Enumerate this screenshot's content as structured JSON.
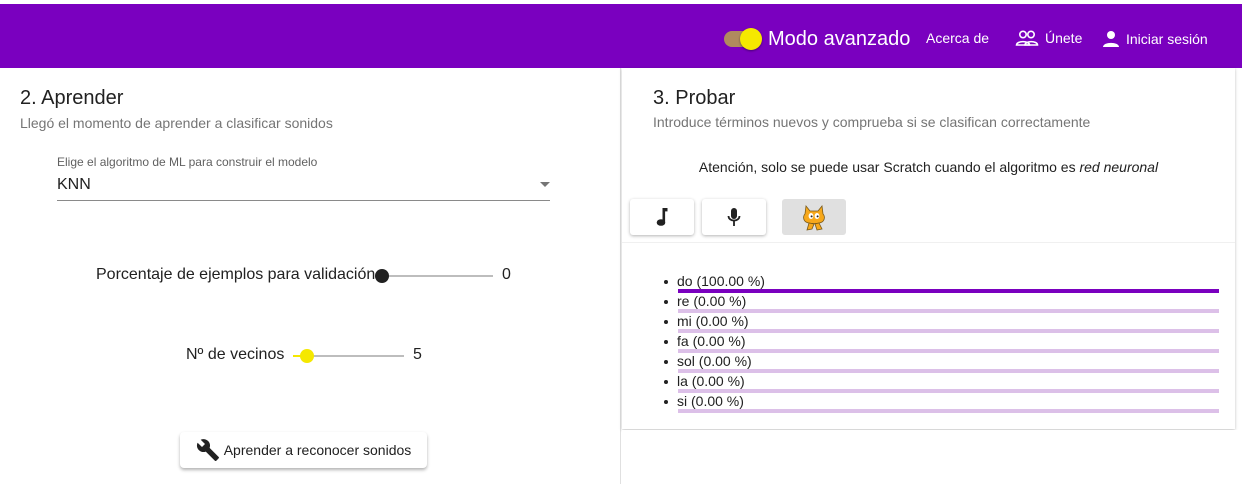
{
  "header": {
    "mode_label": "Modo avanzado",
    "nav": {
      "about": "Acerca de",
      "join": "Únete",
      "login": "Iniciar sesión"
    },
    "accent_color": "#7a00bf"
  },
  "learn": {
    "title": "2. Aprender",
    "subtitle": "Llegó el momento de aprender a clasificar sonidos",
    "algorithm": {
      "label": "Elige el algoritmo de ML para construir el modelo",
      "value": "KNN"
    },
    "validation": {
      "label": "Porcentaje de ejemplos para validación",
      "value": "0"
    },
    "neighbors": {
      "label": "Nº de vecinos",
      "value": "5"
    },
    "train_button": "Aprender a reconocer sonidos"
  },
  "test": {
    "title": "3. Probar",
    "subtitle": "Introduce términos nuevos y comprueba si se clasifican correctamente",
    "notice_prefix": "Atención, solo se puede usar Scratch cuando el algoritmo es ",
    "notice_emphasis": "red neuronal",
    "tabs": [
      "music-note-icon",
      "microphone-icon",
      "scratch-cat-icon"
    ],
    "results": [
      {
        "label": "do (100.00 %)",
        "value": 100
      },
      {
        "label": "re (0.00 %)",
        "value": 0
      },
      {
        "label": "mi (0.00 %)",
        "value": 0
      },
      {
        "label": "fa (0.00 %)",
        "value": 0
      },
      {
        "label": "sol (0.00 %)",
        "value": 0
      },
      {
        "label": "la (0.00 %)",
        "value": 0
      },
      {
        "label": "si (0.00 %)",
        "value": 0
      }
    ]
  }
}
